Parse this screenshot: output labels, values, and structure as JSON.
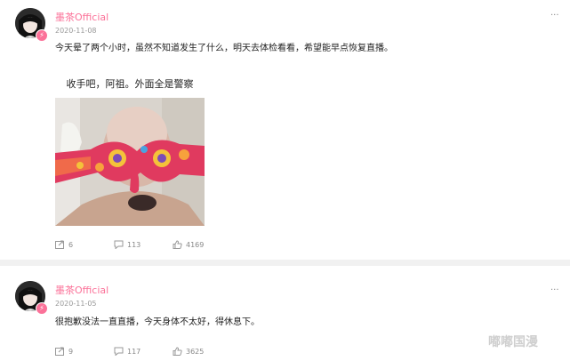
{
  "posts": [
    {
      "username": "墨茶Official",
      "date": "2020-11-08",
      "more": "···",
      "text": "今天晕了两个小时，虽然不知道发生了什么，明天去体检看看，希望能早点恢复直播。",
      "meme_caption": "收手吧，阿祖。外面全是警察",
      "forward_count": "6",
      "comment_count": "113",
      "like_count": "4169"
    },
    {
      "username": "墨茶Official",
      "date": "2020-11-05",
      "more": "···",
      "text": "很抱歉没法一直直播，今天身体不太好，得休息下。",
      "forward_count": "9",
      "comment_count": "117",
      "like_count": "3625"
    }
  ],
  "watermark": "嘟嘟国漫",
  "colors": {
    "accent": "#fb7299",
    "meta": "#999999",
    "separator": "#f1f1f1"
  },
  "icons": [
    "forward-icon",
    "comment-icon",
    "like-icon",
    "verified-badge-icon"
  ]
}
